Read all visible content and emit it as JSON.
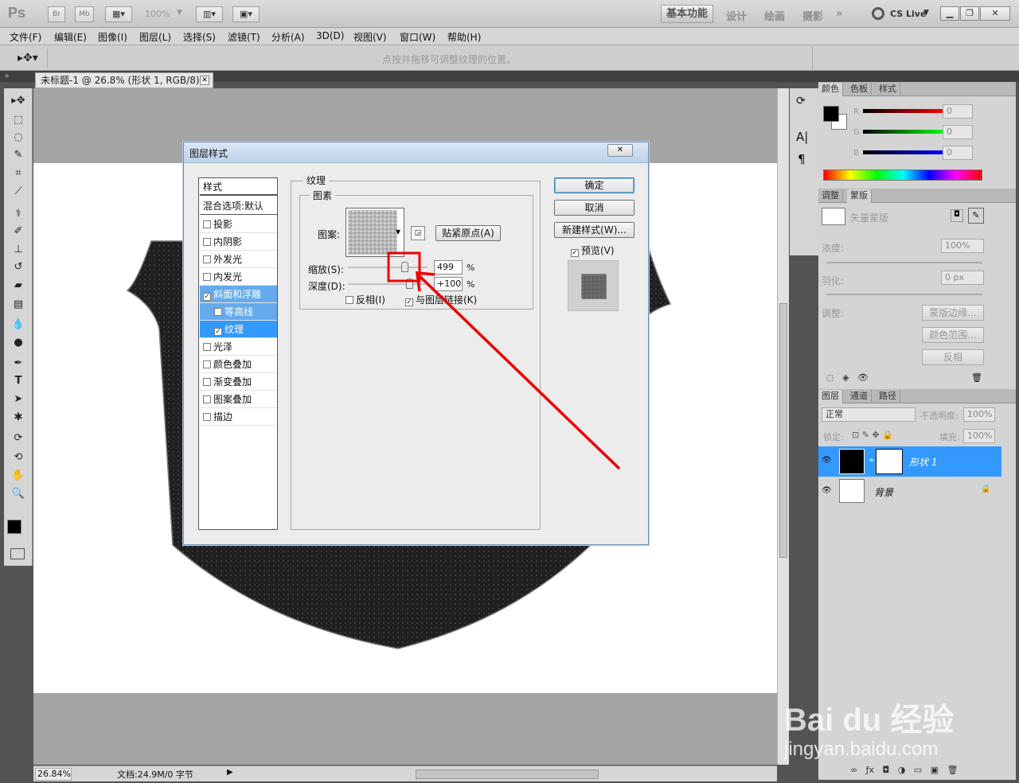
{
  "app": {
    "logo": "Ps",
    "badges": [
      "Br",
      "Mb"
    ],
    "zoom": "100%",
    "workspaces": [
      "基本功能",
      "设计",
      "绘画",
      "摄影",
      "»"
    ],
    "cs_live": "CS Live"
  },
  "menu": [
    "文件(F)",
    "编辑(E)",
    "图像(I)",
    "图层(L)",
    "选择(S)",
    "滤镜(T)",
    "分析(A)",
    "3D(D)",
    "视图(V)",
    "窗口(W)",
    "帮助(H)"
  ],
  "options_hint": "点按并拖移可调整纹理的位置。",
  "document": {
    "tab_title": "未标题-1 @ 26.8% (形状 1, RGB/8) *",
    "zoom": "26.84%",
    "doc_info": "文档:24.9M/0 字节"
  },
  "dialog": {
    "title": "图层样式",
    "styles_header": "样式",
    "blend_default": "混合选项:默认",
    "styles": [
      {
        "label": "投影",
        "checked": false
      },
      {
        "label": "内阴影",
        "checked": false
      },
      {
        "label": "外发光",
        "checked": false
      },
      {
        "label": "内发光",
        "checked": false
      },
      {
        "label": "斜面和浮雕",
        "checked": true
      },
      {
        "label": "等高线",
        "checked": false
      },
      {
        "label": "纹理",
        "checked": true
      },
      {
        "label": "光泽",
        "checked": false
      },
      {
        "label": "颜色叠加",
        "checked": false
      },
      {
        "label": "渐变叠加",
        "checked": false
      },
      {
        "label": "图案叠加",
        "checked": false
      },
      {
        "label": "描边",
        "checked": false
      }
    ],
    "section_title": "纹理",
    "group_title": "图素",
    "pattern_label": "图案:",
    "snap_button": "贴紧原点(A)",
    "scale_label": "缩放(S):",
    "scale_value": "499",
    "depth_label": "深度(D):",
    "depth_value": "+100",
    "percent": "%",
    "invert_label": "反相(I)",
    "link_label": "与图层链接(K)",
    "link_checked": true,
    "ok": "确定",
    "cancel": "取消",
    "new_style": "新建样式(W)...",
    "preview_label": "预览(V)",
    "preview_checked": true
  },
  "color_panel": {
    "tabs": [
      "颜色",
      "色板",
      "样式"
    ],
    "channels": [
      {
        "name": "R",
        "value": "0"
      },
      {
        "name": "G",
        "value": "0"
      },
      {
        "name": "B",
        "value": "0"
      }
    ]
  },
  "mask_panel": {
    "tabs": [
      "调整",
      "蒙版"
    ],
    "mask_type": "矢量蒙版",
    "density_label": "浓度:",
    "density_value": "100%",
    "feather_label": "羽化:",
    "feather_value": "0 px",
    "refine_label": "调整:",
    "mask_edge": "蒙版边缘...",
    "color_range": "颜色范围...",
    "invert": "反相"
  },
  "layers_panel": {
    "tabs": [
      "图层",
      "通道",
      "路径"
    ],
    "blend_mode": "正常",
    "opacity_label": "不透明度:",
    "opacity": "100%",
    "lock_label": "锁定:",
    "fill_label": "填充:",
    "fill": "100%",
    "layers": [
      {
        "name": "形状 1",
        "selected": true
      },
      {
        "name": "背景",
        "selected": false
      }
    ]
  },
  "watermark": {
    "brand": "Bai du 经验",
    "url": "jingyan.baidu.com"
  },
  "colors": {
    "selection": "#3399ff",
    "annotation": "#ee0000"
  }
}
